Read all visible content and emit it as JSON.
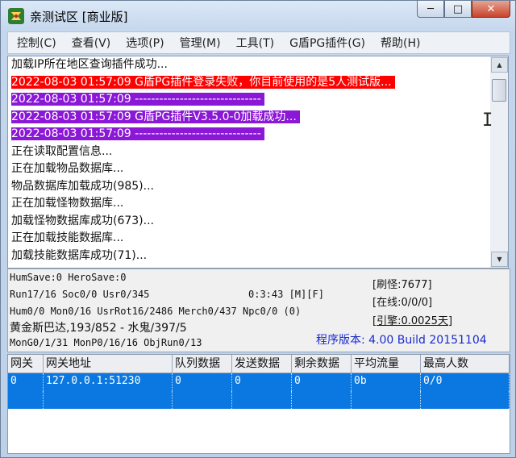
{
  "window": {
    "title": "亲测试区 [商业版]",
    "controls": {
      "minimize": "─",
      "maximize": "□",
      "close": "✕"
    }
  },
  "menu": [
    "控制(C)",
    "查看(V)",
    "选项(P)",
    "管理(M)",
    "工具(T)",
    "G盾PG插件(G)",
    "帮助(H)"
  ],
  "log": [
    {
      "text": "加载IP所在地区查询插件成功...",
      "style": "normal"
    },
    {
      "text": "2022-08-03 01:57:09 G盾PG插件登录失败，你目前使用的是5人测试版...",
      "style": "red"
    },
    {
      "text": "2022-08-03 01:57:09 -------------------------------",
      "style": "purple"
    },
    {
      "text": "2022-08-03 01:57:09 G盾PG插件V3.5.0-0加载成功...",
      "style": "purple"
    },
    {
      "text": "2022-08-03 01:57:09 -------------------------------",
      "style": "purple"
    },
    {
      "text": "正在读取配置信息...",
      "style": "normal"
    },
    {
      "text": "正在加载物品数据库...",
      "style": "normal"
    },
    {
      "text": "物品数据库加载成功(985)...",
      "style": "normal"
    },
    {
      "text": "正在加载怪物数据库...",
      "style": "normal"
    },
    {
      "text": "加载怪物数据库成功(673)...",
      "style": "normal"
    },
    {
      "text": "正在加载技能数据库...",
      "style": "normal"
    },
    {
      "text": "加载技能数据库成功(71)...",
      "style": "normal"
    }
  ],
  "status": {
    "line1": "HumSave:0 HeroSave:0",
    "line2": "Run17/16 Soc0/0 Usr0/345",
    "runtime": "0:3:43 [M][F]",
    "line3": "Hum0/0 Mon0/16 UsrRot16/2486 Merch0/437 Npc0/0 (0)",
    "line4": "黄金斯巴达,193/852 - 水鬼/397/5",
    "line5": "MonG0/1/31 MonP0/16/16 ObjRun0/13",
    "refresh": "[刷怪:7677]",
    "online": "[在线:0/0/0]",
    "engine": "[引擎:0.0025天]",
    "version": "程序版本: 4.00 Build 20151104"
  },
  "table": {
    "headers": [
      "网关",
      "网关地址",
      "队列数据",
      "发送数据",
      "剩余数据",
      "平均流量",
      "最高人数"
    ],
    "rows": [
      [
        "0",
        "127.0.0.1:51230",
        "0",
        "0",
        "0",
        "0b",
        "0/0"
      ],
      [
        "",
        "",
        "",
        "",
        "",
        "",
        ""
      ]
    ]
  },
  "colors": {
    "log_red": "#ff0000",
    "log_purple": "#8a18d6",
    "selection": "#0a78e0",
    "version_text": "#1a2ccf"
  }
}
